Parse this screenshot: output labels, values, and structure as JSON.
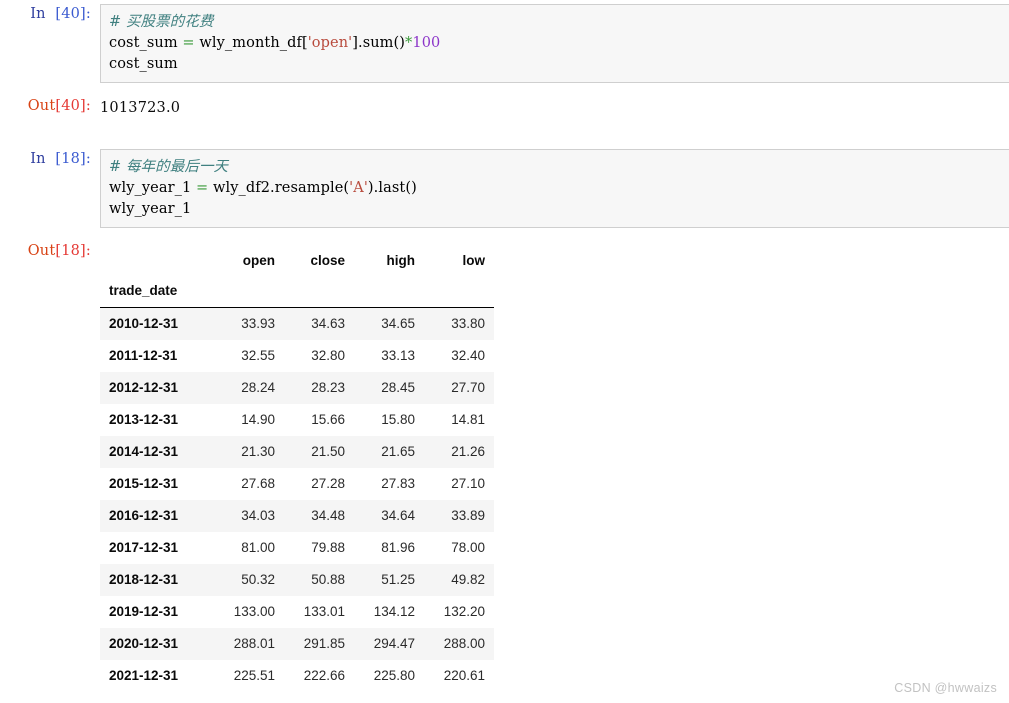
{
  "notebook": {
    "cells": [
      {
        "type": "code",
        "in_prompt_label": "In",
        "in_prompt_index": "[40]:",
        "code_lines": [
          {
            "segments": [
              {
                "text": "# 买股票的花费",
                "token": "comment"
              }
            ]
          },
          {
            "segments": [
              {
                "text": "cost_sum ",
                "token": "plain"
              },
              {
                "text": "=",
                "token": "op"
              },
              {
                "text": " wly_month_df[",
                "token": "plain"
              },
              {
                "text": "'open'",
                "token": "string"
              },
              {
                "text": "].sum()",
                "token": "plain"
              },
              {
                "text": "*",
                "token": "op"
              },
              {
                "text": "100",
                "token": "number"
              }
            ]
          },
          {
            "segments": [
              {
                "text": "cost_sum",
                "token": "plain"
              }
            ]
          }
        ],
        "out_prompt_label": "Out",
        "out_prompt_index": "[40]:",
        "output_type": "text",
        "output_text": "1013723.0"
      },
      {
        "type": "code",
        "in_prompt_label": "In",
        "in_prompt_index": "[18]:",
        "code_lines": [
          {
            "segments": [
              {
                "text": "# 每年的最后一天",
                "token": "comment"
              }
            ]
          },
          {
            "segments": [
              {
                "text": "wly_year_1 ",
                "token": "plain"
              },
              {
                "text": "=",
                "token": "op"
              },
              {
                "text": " wly_df2.resample(",
                "token": "plain"
              },
              {
                "text": "'A'",
                "token": "string"
              },
              {
                "text": ").last()",
                "token": "plain"
              }
            ]
          },
          {
            "segments": [
              {
                "text": "wly_year_1",
                "token": "plain"
              }
            ]
          }
        ],
        "out_prompt_label": "Out",
        "out_prompt_index": "[18]:",
        "output_type": "dataframe"
      }
    ]
  },
  "dataframe": {
    "index_name": "trade_date",
    "columns": [
      "open",
      "close",
      "high",
      "low"
    ],
    "index": [
      "2010-12-31",
      "2011-12-31",
      "2012-12-31",
      "2013-12-31",
      "2014-12-31",
      "2015-12-31",
      "2016-12-31",
      "2017-12-31",
      "2018-12-31",
      "2019-12-31",
      "2020-12-31",
      "2021-12-31"
    ],
    "rows": [
      [
        "33.93",
        "34.63",
        "34.65",
        "33.80"
      ],
      [
        "32.55",
        "32.80",
        "33.13",
        "32.40"
      ],
      [
        "28.24",
        "28.23",
        "28.45",
        "27.70"
      ],
      [
        "14.90",
        "15.66",
        "15.80",
        "14.81"
      ],
      [
        "21.30",
        "21.50",
        "21.65",
        "21.26"
      ],
      [
        "27.68",
        "27.28",
        "27.83",
        "27.10"
      ],
      [
        "34.03",
        "34.48",
        "34.64",
        "33.89"
      ],
      [
        "81.00",
        "79.88",
        "81.96",
        "78.00"
      ],
      [
        "50.32",
        "50.88",
        "51.25",
        "49.82"
      ],
      [
        "133.00",
        "133.01",
        "134.12",
        "132.20"
      ],
      [
        "288.01",
        "291.85",
        "294.47",
        "288.00"
      ],
      [
        "225.51",
        "222.66",
        "225.80",
        "220.61"
      ]
    ]
  },
  "watermark": {
    "text": "CSDN @hwwaizs"
  },
  "colors": {
    "in_prompt": "#303f9f",
    "out_prompt": "#d84315",
    "out_prompt_bracket": "#e53935",
    "comment": "#408080",
    "string": "#b84a3c",
    "number": "#8c35c9",
    "operator": "#3a9a3a",
    "cell_background": "#f7f7f7",
    "cell_border": "#cfcfcf",
    "row_stripe": "#f5f5f5",
    "watermark": "#c2c2c2"
  }
}
